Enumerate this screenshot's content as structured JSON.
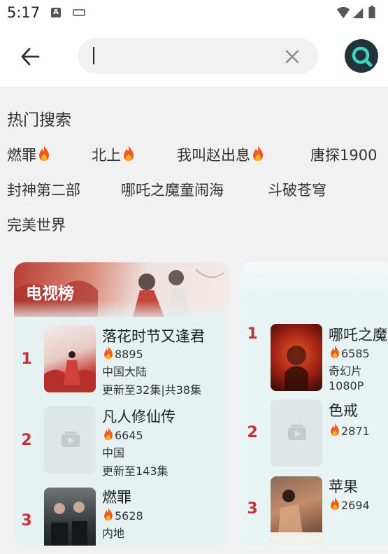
{
  "status_bar": {
    "time": "5:17",
    "notif_letter": "A"
  },
  "search": {
    "value": "",
    "placeholder": ""
  },
  "hot_search": {
    "title": "热门搜索",
    "items": [
      {
        "label": "燃罪",
        "hot": true
      },
      {
        "label": "北上",
        "hot": true
      },
      {
        "label": "我叫赵出息",
        "hot": true
      },
      {
        "label": "唐探1900",
        "hot": false
      },
      {
        "label": "封神第二部",
        "hot": false
      },
      {
        "label": "哪吒之魔童闹海",
        "hot": false
      },
      {
        "label": "斗破苍穹",
        "hot": false
      },
      {
        "label": "完美世界",
        "hot": false
      }
    ]
  },
  "tv_board": {
    "title": "电视榜",
    "items": [
      {
        "rank": "1",
        "title": "落花时节又逢君",
        "heat": "8895",
        "region": "中国大陆",
        "update": "更新至32集|共38集"
      },
      {
        "rank": "2",
        "title": "凡人修仙传",
        "heat": "6645",
        "region": "中国",
        "update": "更新至143集"
      },
      {
        "rank": "3",
        "title": "燃罪",
        "heat": "5628",
        "region": "内地",
        "update": ""
      }
    ]
  },
  "movie_board": {
    "items": [
      {
        "rank": "1",
        "title": "哪吒之魔童闹海",
        "heat": "6585",
        "genre": "奇幻片",
        "quality": "1080P"
      },
      {
        "rank": "2",
        "title": "色戒",
        "heat": "2871",
        "genre": "",
        "quality": ""
      },
      {
        "rank": "3",
        "title": "苹果",
        "heat": "2694",
        "genre": "",
        "quality": ""
      }
    ]
  },
  "colors": {
    "accent": "#20343a",
    "rank": "#c8303a",
    "fire": "#f05a1e",
    "search_icon": "#3dd6c0"
  }
}
